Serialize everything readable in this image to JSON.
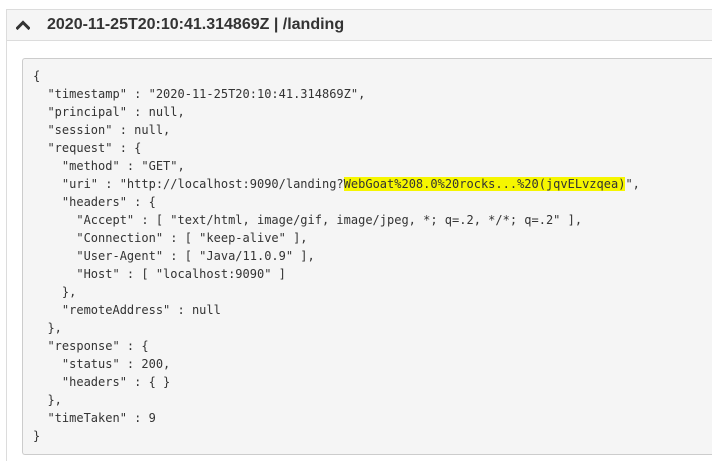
{
  "header": {
    "title": "2020-11-25T20:10:41.314869Z | /landing",
    "toggle_icon": "chevron-up-icon"
  },
  "trace": {
    "lines": [
      {
        "text": "{"
      },
      {
        "text": "  \"timestamp\" : \"2020-11-25T20:10:41.314869Z\","
      },
      {
        "text": "  \"principal\" : null,"
      },
      {
        "text": "  \"session\" : null,"
      },
      {
        "text": "  \"request\" : {"
      },
      {
        "text": "    \"method\" : \"GET\","
      },
      {
        "pre": "    \"uri\" : \"http://localhost:9090/landing?",
        "highlight": "WebGoat%208.0%20rocks...%20(jqvELvzqea)",
        "post": "\","
      },
      {
        "text": "    \"headers\" : {"
      },
      {
        "text": "      \"Accept\" : [ \"text/html, image/gif, image/jpeg, *; q=.2, */*; q=.2\" ],"
      },
      {
        "text": "      \"Connection\" : [ \"keep-alive\" ],"
      },
      {
        "text": "      \"User-Agent\" : [ \"Java/11.0.9\" ],"
      },
      {
        "text": "      \"Host\" : [ \"localhost:9090\" ]"
      },
      {
        "text": "    },"
      },
      {
        "text": "    \"remoteAddress\" : null"
      },
      {
        "text": "  },"
      },
      {
        "text": "  \"response\" : {"
      },
      {
        "text": "    \"status\" : 200,"
      },
      {
        "text": "    \"headers\" : { }"
      },
      {
        "text": "  },"
      },
      {
        "text": "  \"timeTaken\" : 9"
      },
      {
        "text": "}"
      }
    ]
  },
  "colors": {
    "highlight": "#f6f600",
    "code_background": "#f5f5f5",
    "header_background": "#f5f5f5"
  }
}
